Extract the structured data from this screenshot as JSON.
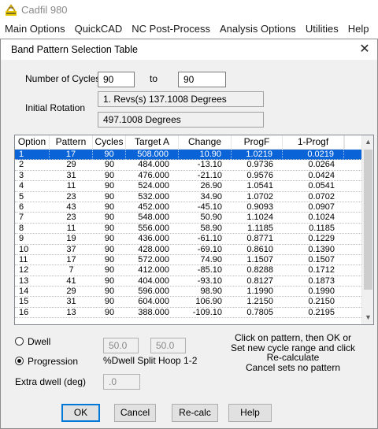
{
  "app": {
    "title": "Cadfil  980",
    "icon": "cadfil-logo-icon"
  },
  "menu": [
    "Main Options",
    "QuickCAD",
    "NC Post-Process",
    "Analysis Options",
    "Utilities",
    "Help"
  ],
  "dialog": {
    "title": "Band Pattern Selection Table",
    "close_symbol": "✕",
    "cycles_label": "Number of Cycles",
    "cycles_from": "90",
    "to_label": "to",
    "cycles_to": "90",
    "initial_rotation_label": "Initial Rotation",
    "rotation_revs": "1. Revs(s)  137.1008 Degrees",
    "rotation_degrees": "497.1008 Degrees",
    "table": {
      "columns": [
        "Option",
        "Pattern",
        "Cycles",
        "Target A",
        "Change",
        "ProgF",
        "1-Progf"
      ],
      "rows": [
        [
          "1",
          "17",
          "90",
          "508.000",
          "10.90",
          "1.0219",
          "0.0219"
        ],
        [
          "2",
          "29",
          "90",
          "484.000",
          "-13.10",
          "0.9736",
          "0.0264"
        ],
        [
          "3",
          "31",
          "90",
          "476.000",
          "-21.10",
          "0.9576",
          "0.0424"
        ],
        [
          "4",
          "11",
          "90",
          "524.000",
          "26.90",
          "1.0541",
          "0.0541"
        ],
        [
          "5",
          "23",
          "90",
          "532.000",
          "34.90",
          "1.0702",
          "0.0702"
        ],
        [
          "6",
          "43",
          "90",
          "452.000",
          "-45.10",
          "0.9093",
          "0.0907"
        ],
        [
          "7",
          "23",
          "90",
          "548.000",
          "50.90",
          "1.1024",
          "0.1024"
        ],
        [
          "8",
          "11",
          "90",
          "556.000",
          "58.90",
          "1.1185",
          "0.1185"
        ],
        [
          "9",
          "19",
          "90",
          "436.000",
          "-61.10",
          "0.8771",
          "0.1229"
        ],
        [
          "10",
          "37",
          "90",
          "428.000",
          "-69.10",
          "0.8610",
          "0.1390"
        ],
        [
          "11",
          "17",
          "90",
          "572.000",
          "74.90",
          "1.1507",
          "0.1507"
        ],
        [
          "12",
          "7",
          "90",
          "412.000",
          "-85.10",
          "0.8288",
          "0.1712"
        ],
        [
          "13",
          "41",
          "90",
          "404.000",
          "-93.10",
          "0.8127",
          "0.1873"
        ],
        [
          "14",
          "29",
          "90",
          "596.000",
          "98.90",
          "1.1990",
          "0.1990"
        ],
        [
          "15",
          "31",
          "90",
          "604.000",
          "106.90",
          "1.2150",
          "0.2150"
        ],
        [
          "16",
          "13",
          "90",
          "388.000",
          "-109.10",
          "0.7805",
          "0.2195"
        ]
      ],
      "selected_row": "1",
      "scroll_up": "▲",
      "scroll_down": "▼"
    },
    "dwell_label": "Dwell",
    "progression_label": "Progression",
    "selected_mode": "Progression",
    "split_value_1": "50.0",
    "split_value_2": "50.0",
    "split_label": "%Dwell Split Hoop 1-2",
    "extra_dwell_label": "Extra dwell (deg)",
    "extra_dwell_value": ".0",
    "instructions": [
      "Click on pattern, then OK or",
      "Set new cycle range and click",
      "Re-calculate",
      "Cancel sets no pattern"
    ],
    "buttons": {
      "ok": "OK",
      "cancel": "Cancel",
      "recalc": "Re-calc",
      "help": "Help"
    }
  },
  "colors": {
    "selection": "#0a64d8",
    "dialog_bg": "#f0f0f0",
    "default_button_border": "#0078d7"
  }
}
